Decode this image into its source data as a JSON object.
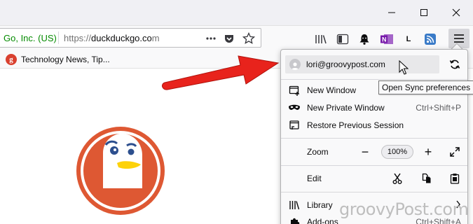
{
  "window": {
    "minimize_icon": "minimize-icon",
    "maximize_icon": "maximize-icon",
    "close_icon": "close-icon"
  },
  "urlbar": {
    "identity": "Go, Inc. (US)",
    "url_scheme": "https://",
    "url_host": "duckduckgo.co",
    "url_tail": "m",
    "page_actions_icon": "ellipsis-icon",
    "pocket_icon": "pocket-icon",
    "bookmark_icon": "star-icon"
  },
  "toolbar": {
    "icons": [
      "library-icon",
      "sidebar-icon",
      "notification-bell-icon",
      "onenote-icon",
      "lastpass-icon",
      "rss-icon"
    ],
    "lastpass_label": "L",
    "menu_icon": "hamburger-menu-icon"
  },
  "bookmarks": {
    "items": [
      {
        "favicon": "g",
        "label": "Technology News, Tip..."
      }
    ]
  },
  "menu": {
    "sync_email": "lori@groovypost.com",
    "sync_tooltip": "Open Sync preferences",
    "items": [
      {
        "label": "New Window",
        "shortcut": "",
        "icon": "new-window-icon"
      },
      {
        "label": "New Private Window",
        "shortcut": "Ctrl+Shift+P",
        "icon": "mask-icon"
      },
      {
        "label": "Restore Previous Session",
        "shortcut": "",
        "icon": "restore-session-icon"
      }
    ],
    "zoom": {
      "label": "Zoom",
      "minus": "−",
      "value": "100%",
      "plus": "+"
    },
    "edit": {
      "label": "Edit"
    },
    "library": {
      "label": "Library"
    },
    "addons": {
      "label": "Add-ons",
      "shortcut": "Ctrl+Shift+A"
    }
  },
  "watermark": "groovyPost.com",
  "colors": {
    "arrow_red": "#e8231c",
    "identity_green": "#058b00",
    "ddg_orange": "#de5833"
  }
}
